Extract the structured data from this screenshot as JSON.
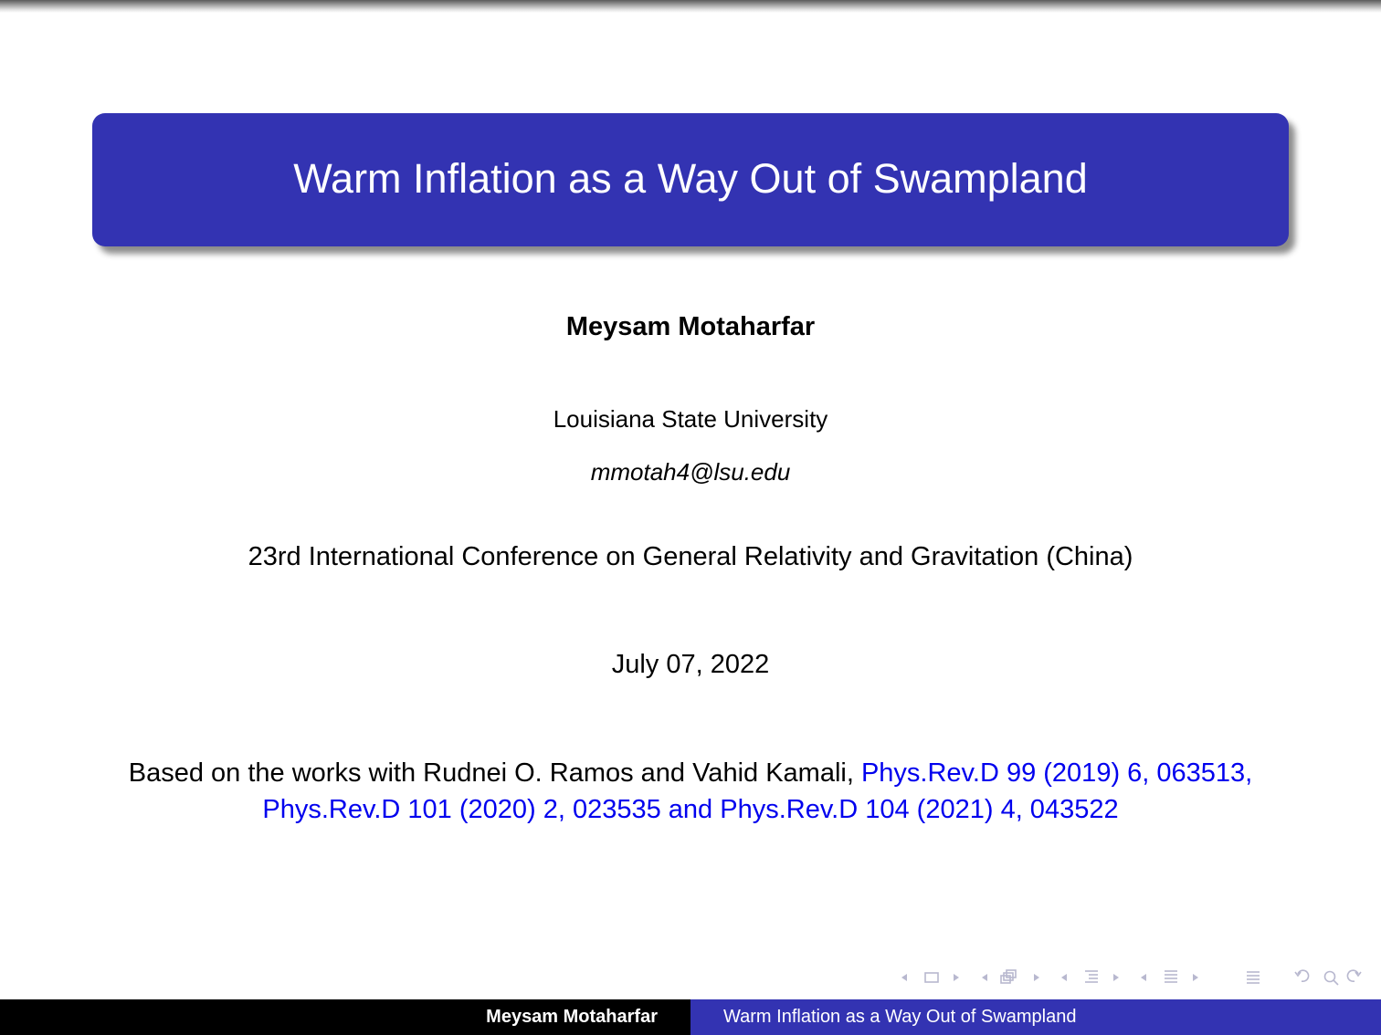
{
  "slide": {
    "title": "Warm Inflation as a Way Out of Swampland",
    "author": "Meysam Motaharfar",
    "institute": "Louisiana State University",
    "email": "mmotah4@lsu.edu",
    "conference": "23rd International Conference on General Relativity and Gravitation (China)",
    "date": "July 07, 2022",
    "based_on_prefix": "Based on the works with Rudnei O. Ramos and Vahid Kamali, ",
    "references": "Phys.Rev.D 99 (2019) 6, 063513, Phys.Rev.D 101 (2020) 2, 023535 and Phys.Rev.D 104 (2021) 4, 043522"
  },
  "colors": {
    "title_box": "#3333b2",
    "footer_left": "#000000",
    "footer_right": "#3333b2",
    "link": "#0000ee",
    "nav_icons": "#b8b8cf"
  },
  "navigation": {
    "icons": [
      "slide-prev-icon",
      "slide-icon",
      "slide-next-icon",
      "frame-prev-icon",
      "frame-icon",
      "frame-next-icon",
      "subsection-prev-icon",
      "subsection-icon",
      "subsection-next-icon",
      "section-prev-icon",
      "section-icon",
      "section-next-icon",
      "toc-icon",
      "undo-icon",
      "search-icon",
      "redo-icon"
    ]
  },
  "footer": {
    "author": "Meysam Motaharfar",
    "title": "Warm Inflation as a Way Out of Swampland"
  }
}
